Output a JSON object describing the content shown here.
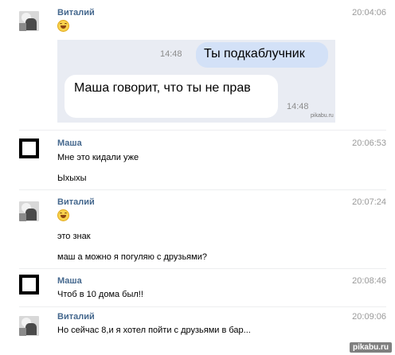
{
  "messages": [
    {
      "author": "Виталий",
      "time": "20:04:06",
      "emoji": "grinning-emoji"
    },
    {
      "author": "Маша",
      "time": "20:06:53",
      "lines": [
        "Мне это кидали уже",
        "Ыхыхы"
      ]
    },
    {
      "author": "Виталий",
      "time": "20:07:24",
      "emoji": "grinning-emoji",
      "lines": [
        "это знак",
        "маш а можно я погуляю с друзьями?"
      ]
    },
    {
      "author": "Маша",
      "time": "20:08:46",
      "lines": [
        "Чтоб в 10 дома был!!"
      ]
    },
    {
      "author": "Виталий",
      "time": "20:09:06",
      "lines": [
        "Но сейчас 8,и я хотел пойти с друзьями в бар..."
      ]
    }
  ],
  "screenshot": {
    "outgoing_text": "Ты подкаблучник",
    "outgoing_time": "14:48",
    "incoming_text": "Маша говорит, что ты не прав",
    "incoming_time": "14:48",
    "watermark": "pikabu.ru"
  },
  "footer": "pikabu.ru",
  "colors": {
    "name": "#45688e",
    "time": "#999999",
    "bubble_out": "#d3e1f7",
    "bubble_bg": "#e9ecf3"
  }
}
